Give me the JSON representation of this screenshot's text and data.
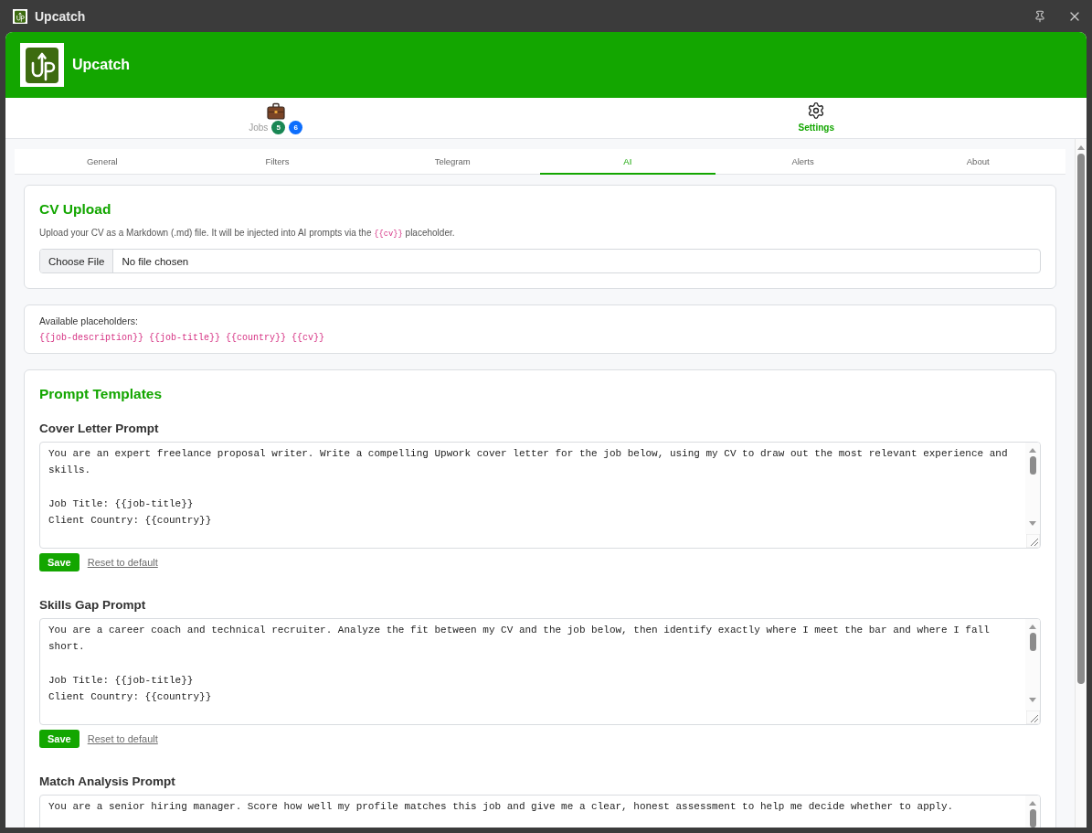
{
  "window": {
    "title": "Upcatch"
  },
  "header": {
    "title": "Upcatch"
  },
  "nav": [
    {
      "kind": "jobs",
      "label": "Jobs",
      "selected": false,
      "badges": [
        {
          "count": "5",
          "color": "#198754"
        },
        {
          "count": "6",
          "color": "#0d6efd"
        }
      ]
    },
    {
      "kind": "settings",
      "label": "Settings",
      "selected": true
    }
  ],
  "tabs": [
    {
      "label": "General",
      "selected": false
    },
    {
      "label": "Filters",
      "selected": false
    },
    {
      "label": "Telegram",
      "selected": false
    },
    {
      "label": "AI",
      "selected": true
    },
    {
      "label": "Alerts",
      "selected": false
    },
    {
      "label": "About",
      "selected": false
    }
  ],
  "cv_upload": {
    "title": "CV Upload",
    "description": {
      "before": "Upload your CV as a Markdown (.md) file. It will be injected into AI prompts via the",
      "code": "{{cv}}",
      "after": "placeholder."
    },
    "file_button": "Choose File",
    "file_status": "No file chosen"
  },
  "placeholders": {
    "label": "Available placeholders:",
    "codes": [
      "{{job-description}}",
      "{{job-title}}",
      "{{country}}",
      "{{cv}}"
    ]
  },
  "prompt_templates": {
    "title": "Prompt Templates",
    "prompts": [
      {
        "label": "Cover Letter Prompt",
        "value": "You are an expert freelance proposal writer. Write a compelling Upwork cover letter for the job below, using my CV to draw out the most relevant experience and skills.\n\nJob Title: {{job-title}}\nClient Country: {{country}}",
        "save": "Save",
        "reset": "Reset to default"
      },
      {
        "label": "Skills Gap Prompt",
        "value": "You are a career coach and technical recruiter. Analyze the fit between my CV and the job below, then identify exactly where I meet the bar and where I fall short.\n\nJob Title: {{job-title}}\nClient Country: {{country}}",
        "save": "Save",
        "reset": "Reset to default"
      },
      {
        "label": "Match Analysis Prompt",
        "value": "You are a senior hiring manager. Score how well my profile matches this job and give me a clear, honest assessment to help me decide whether to apply."
      }
    ]
  }
}
